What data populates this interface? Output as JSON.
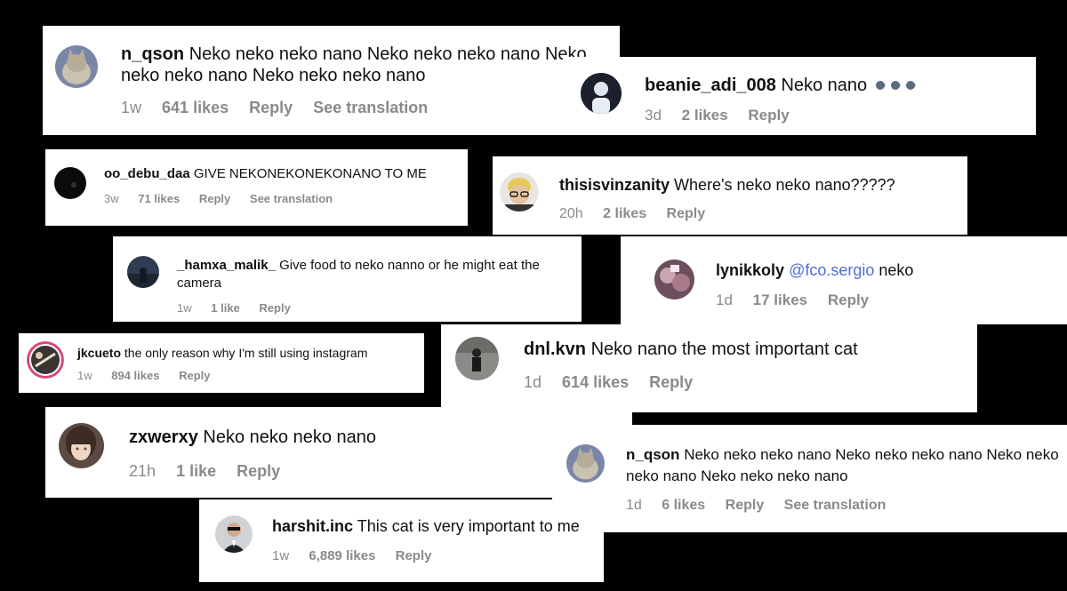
{
  "comments": [
    {
      "username": "n_qson",
      "text": "Neko neko neko nano Neko neko neko nano Neko neko neko nano Neko neko neko nano",
      "time": "1w",
      "likes": "641 likes",
      "reply": "Reply",
      "translate": "See translation",
      "avatar": "cat-avatar"
    },
    {
      "username": "beanie_adi_008",
      "text": "Neko nano",
      "emoji": [
        "speaking-head-icon",
        "speaking-head-icon",
        "speaking-head-icon"
      ],
      "time": "3d",
      "likes": "2 likes",
      "reply": "Reply",
      "avatar": "dark-figure-avatar"
    },
    {
      "username": "oo_debu_daa",
      "text": "GIVE NEKONEKONEKONANO TO ME",
      "time": "3w",
      "likes": "71 likes",
      "reply": "Reply",
      "translate": "See translation",
      "avatar": "black-avatar"
    },
    {
      "username": "thisisvinzanity",
      "text": "Where's neko neko nano?????",
      "time": "20h",
      "likes": "2 likes",
      "reply": "Reply",
      "avatar": "person-glasses-avatar"
    },
    {
      "username": "_hamxa_malik_",
      "text": "Give food to neko nanno or he might eat the camera",
      "time": "1w",
      "likes": "1 like",
      "reply": "Reply",
      "avatar": "landscape-avatar"
    },
    {
      "username": "lynikkoly",
      "mention": "@fco.sergio",
      "text": "neko",
      "time": "1d",
      "likes": "17 likes",
      "reply": "Reply",
      "avatar": "photo-avatar"
    },
    {
      "username": "jkcueto",
      "text": "the only reason why I'm still using instagram",
      "time": "1w",
      "likes": "894 likes",
      "reply": "Reply",
      "avatar": "story-ring-avatar"
    },
    {
      "username": "dnl.kvn",
      "text": "Neko nano the most important cat",
      "time": "1d",
      "likes": "614 likes",
      "reply": "Reply",
      "avatar": "standing-person-avatar"
    },
    {
      "username": "zxwerxy",
      "text": "Neko neko neko nano",
      "time": "21h",
      "likes": "1 like",
      "reply": "Reply",
      "avatar": "anime-avatar"
    },
    {
      "username": "n_qson",
      "text": "Neko neko neko nano Neko neko neko nano Neko neko neko nano Neko neko neko nano",
      "time": "1d",
      "likes": "6 likes",
      "reply": "Reply",
      "translate": "See translation",
      "avatar": "cat-avatar"
    },
    {
      "username": "harshit.inc",
      "text": "This cat is very important to me",
      "time": "1w",
      "likes": "6,889 likes",
      "reply": "Reply",
      "avatar": "suit-person-avatar"
    }
  ]
}
